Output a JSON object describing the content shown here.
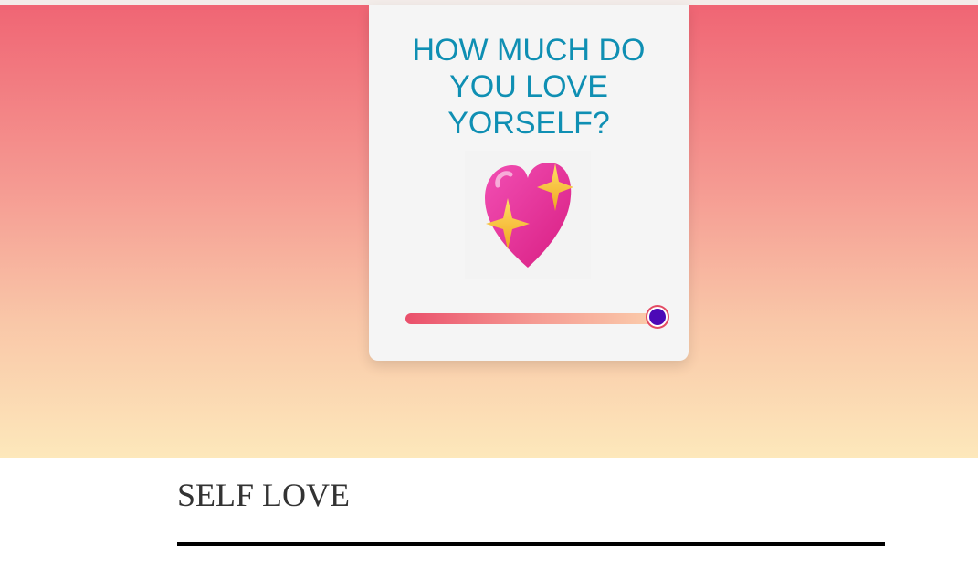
{
  "card": {
    "title": "HOW MUCH DO\nYOU LOVE\nYORSELF?",
    "emoji_icon": "sparkling-heart-icon"
  },
  "slider": {
    "value_fraction": 1.0
  },
  "section": {
    "title": "SELF LOVE"
  },
  "colors": {
    "title": "#0f8fb3",
    "thumb": "#4c08b7",
    "heart": "#e8359b",
    "sparkle": "#f7c531"
  }
}
